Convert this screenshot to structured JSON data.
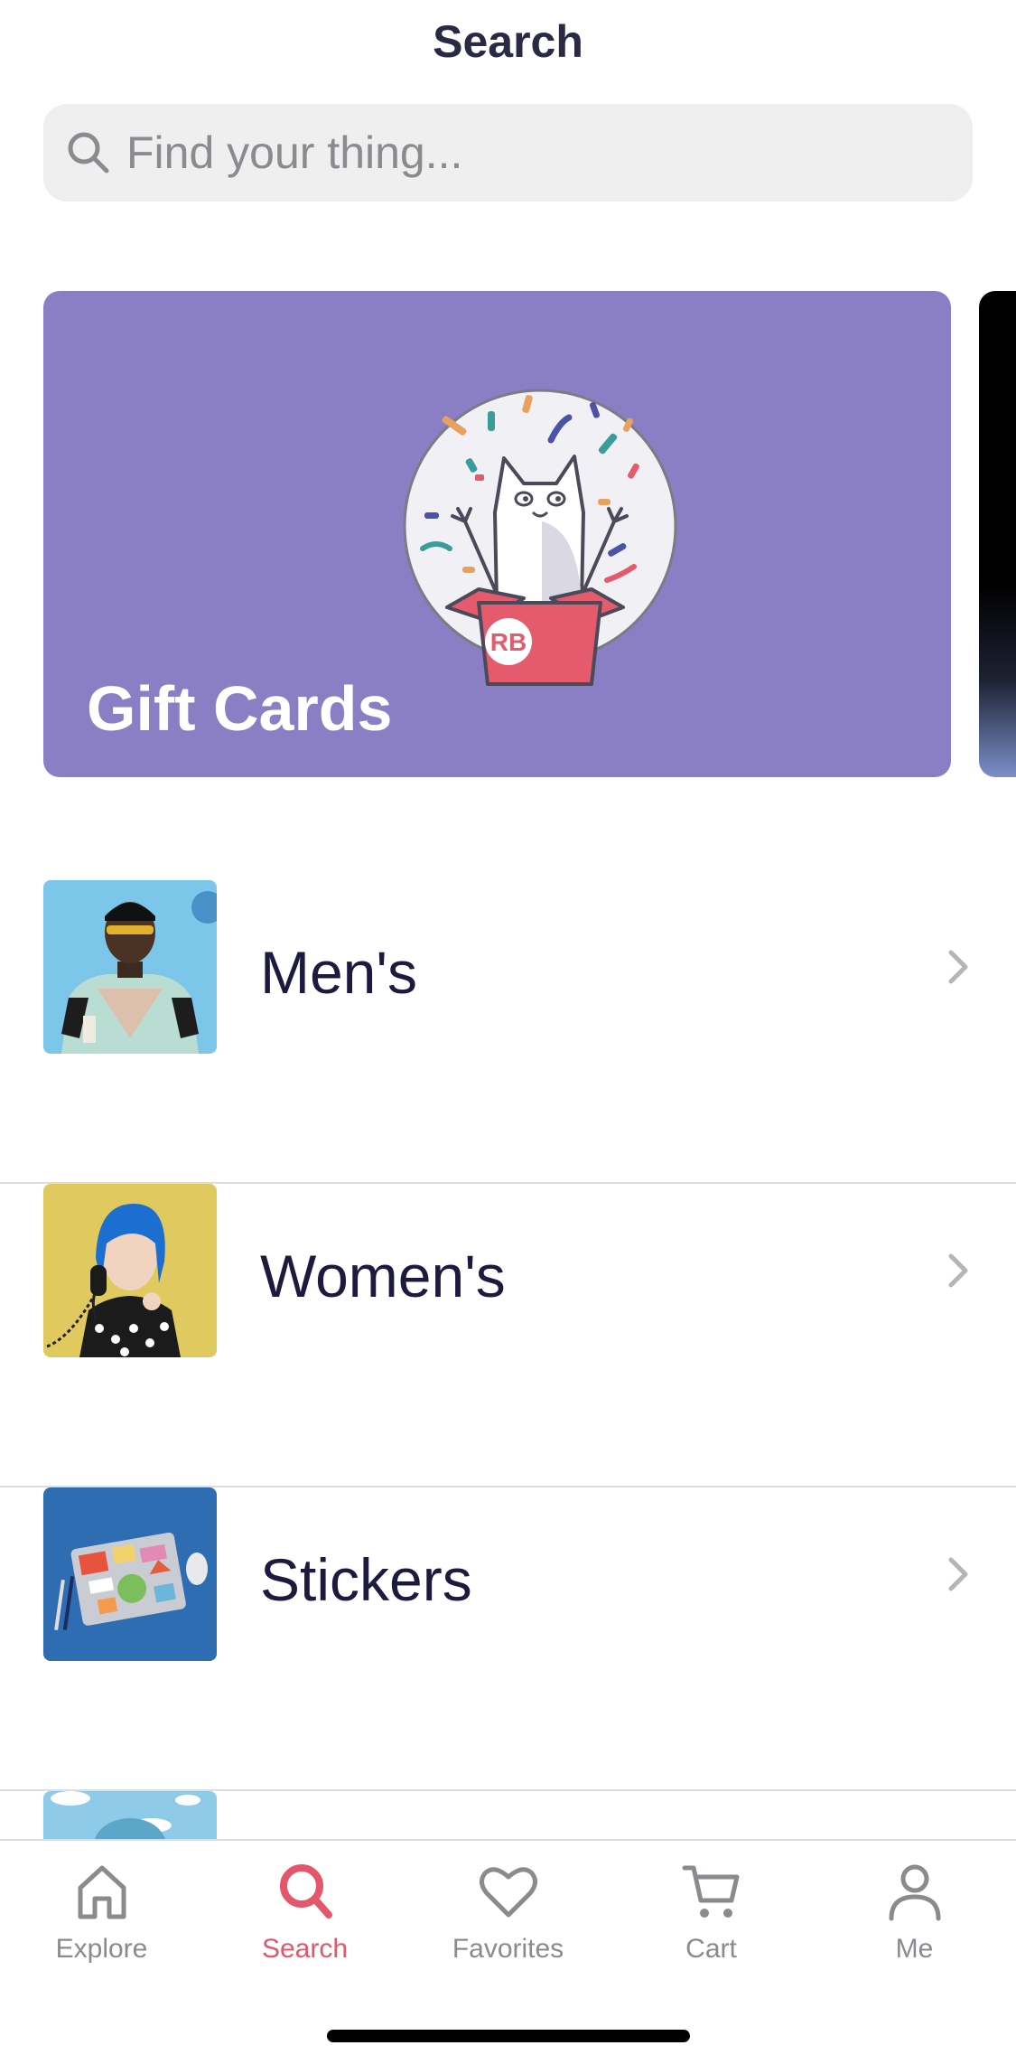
{
  "header": {
    "title": "Search"
  },
  "search": {
    "placeholder": "Find your thing..."
  },
  "carousel": {
    "cards": [
      {
        "label": "Gift Cards",
        "background": "#8a7fc4",
        "art_logo_text": "RB"
      }
    ]
  },
  "categories": [
    {
      "label": "Men's"
    },
    {
      "label": "Women's"
    },
    {
      "label": "Stickers"
    }
  ],
  "tabbar": {
    "items": [
      {
        "label": "Explore",
        "icon": "home-icon",
        "active": false
      },
      {
        "label": "Search",
        "icon": "search-icon",
        "active": true
      },
      {
        "label": "Favorites",
        "icon": "heart-icon",
        "active": false
      },
      {
        "label": "Cart",
        "icon": "cart-icon",
        "active": false
      },
      {
        "label": "Me",
        "icon": "person-icon",
        "active": false
      }
    ]
  },
  "colors": {
    "accent": "#e4566b",
    "inactive_tab": "#8a8a8f",
    "text_primary": "#1c1a3f",
    "gift_card_bg": "#8a7fc4"
  }
}
